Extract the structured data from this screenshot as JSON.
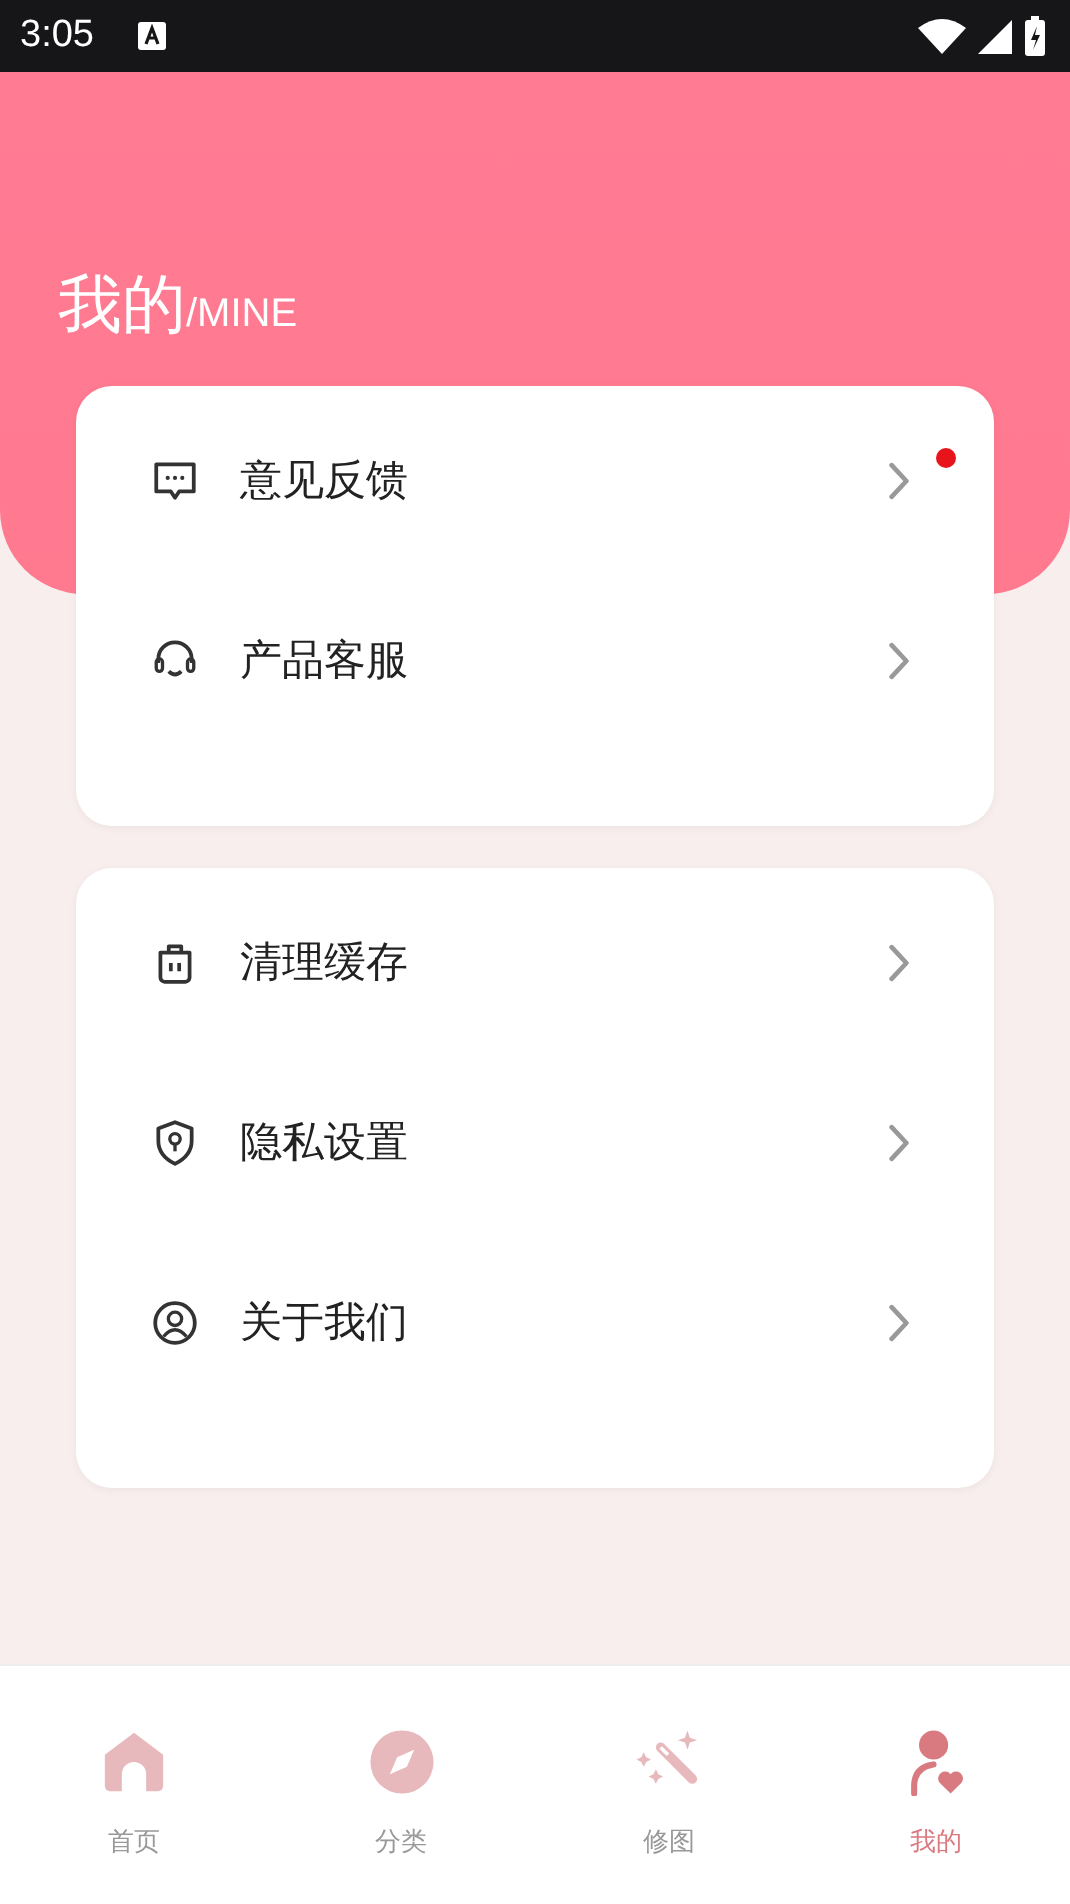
{
  "status_bar": {
    "time": "3:05"
  },
  "header": {
    "title": "我的",
    "subtitle": "/MINE"
  },
  "groups": [
    {
      "items": [
        {
          "label": "意见反馈",
          "badge": true
        },
        {
          "label": "产品客服",
          "badge": false
        }
      ]
    },
    {
      "items": [
        {
          "label": "清理缓存",
          "badge": false
        },
        {
          "label": "隐私设置",
          "badge": false
        },
        {
          "label": "关于我们",
          "badge": false
        }
      ]
    }
  ],
  "tabs": [
    {
      "label": "首页",
      "selected": false
    },
    {
      "label": "分类",
      "selected": false
    },
    {
      "label": "修图",
      "selected": false
    },
    {
      "label": "我的",
      "selected": true
    }
  ]
}
